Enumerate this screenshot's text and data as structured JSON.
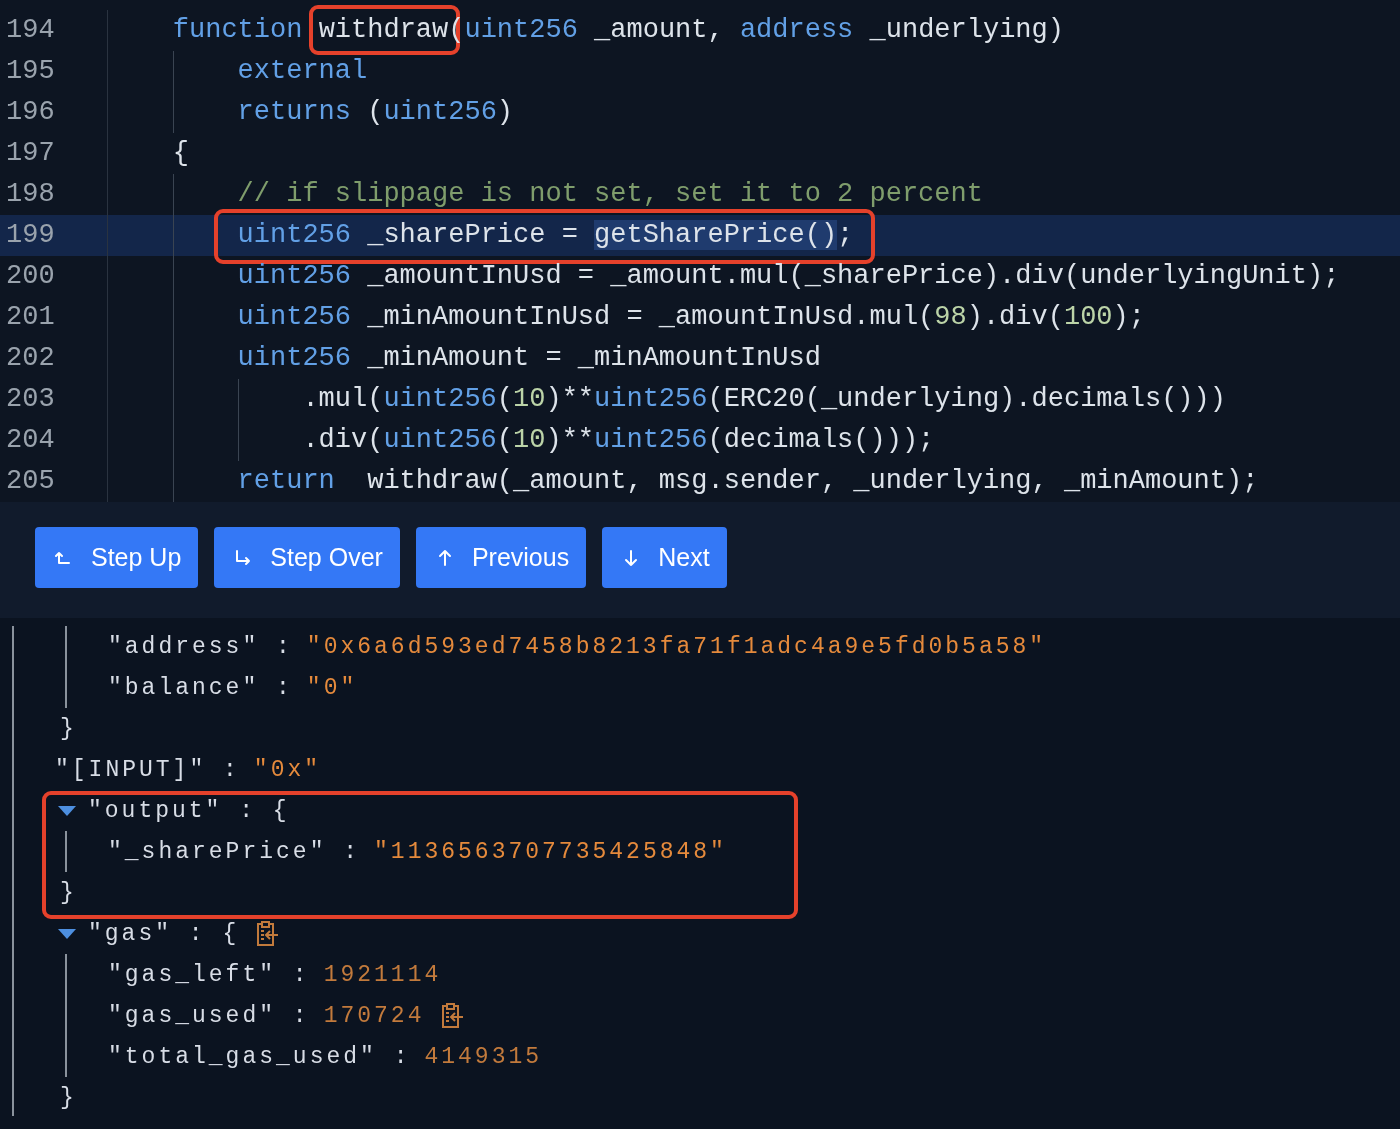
{
  "code_view": {
    "lines": [
      {
        "number": "194",
        "current": false,
        "segments": [
          {
            "kind": "keyword",
            "text": "function "
          },
          {
            "kind": "plain",
            "text": "withdraw",
            "boxed": true
          },
          {
            "kind": "plain",
            "text": "("
          },
          {
            "kind": "keyword",
            "text": "uint256"
          },
          {
            "kind": "plain",
            "text": " _amount, "
          },
          {
            "kind": "keyword",
            "text": "address"
          },
          {
            "kind": "plain",
            "text": " _underlying)"
          }
        ],
        "children": [
          {
            "number": "195",
            "current": false,
            "segments": [
              {
                "kind": "keyword",
                "text": "external"
              }
            ]
          },
          {
            "number": "196",
            "current": false,
            "segments": [
              {
                "kind": "keyword",
                "text": "returns"
              },
              {
                "kind": "plain",
                "text": " ("
              },
              {
                "kind": "keyword",
                "text": "uint256"
              },
              {
                "kind": "plain",
                "text": ")"
              }
            ]
          }
        ]
      },
      {
        "number": "197",
        "current": false,
        "segments": [
          {
            "kind": "plain",
            "text": "{"
          }
        ],
        "children": [
          {
            "number": "198",
            "current": false,
            "segments": [
              {
                "kind": "comment",
                "text": "// if slippage is not set, set it to 2 percent"
              }
            ]
          },
          {
            "number": "199",
            "current": true,
            "boxed": true,
            "segments": [
              {
                "kind": "keyword",
                "text": "uint256"
              },
              {
                "kind": "plain",
                "text": " _sharePrice = "
              },
              {
                "kind": "selection",
                "text": "getSharePrice()"
              },
              {
                "kind": "plain",
                "text": ";"
              }
            ]
          },
          {
            "number": "200",
            "current": false,
            "segments": [
              {
                "kind": "keyword",
                "text": "uint256"
              },
              {
                "kind": "plain",
                "text": " _amountInUsd = _amount.mul(_sharePrice).div(underlyingUnit);"
              }
            ]
          },
          {
            "number": "201",
            "current": false,
            "segments": [
              {
                "kind": "keyword",
                "text": "uint256"
              },
              {
                "kind": "plain",
                "text": " _minAmountInUsd = _amountInUsd.mul("
              },
              {
                "kind": "number",
                "text": "98"
              },
              {
                "kind": "plain",
                "text": ").div("
              },
              {
                "kind": "number",
                "text": "100"
              },
              {
                "kind": "plain",
                "text": ");"
              }
            ]
          },
          {
            "number": "202",
            "current": false,
            "segments": [
              {
                "kind": "keyword",
                "text": "uint256"
              },
              {
                "kind": "plain",
                "text": " _minAmount = _minAmountInUsd"
              }
            ],
            "children": [
              {
                "number": "203",
                "current": false,
                "segments": [
                  {
                    "kind": "plain",
                    "text": ".mul("
                  },
                  {
                    "kind": "keyword",
                    "text": "uint256"
                  },
                  {
                    "kind": "plain",
                    "text": "("
                  },
                  {
                    "kind": "number",
                    "text": "10"
                  },
                  {
                    "kind": "plain",
                    "text": ")**"
                  },
                  {
                    "kind": "keyword",
                    "text": "uint256"
                  },
                  {
                    "kind": "plain",
                    "text": "(ERC20(_underlying).decimals()))"
                  }
                ]
              },
              {
                "number": "204",
                "current": false,
                "segments": [
                  {
                    "kind": "plain",
                    "text": ".div("
                  },
                  {
                    "kind": "keyword",
                    "text": "uint256"
                  },
                  {
                    "kind": "plain",
                    "text": "("
                  },
                  {
                    "kind": "number",
                    "text": "10"
                  },
                  {
                    "kind": "plain",
                    "text": ")**"
                  },
                  {
                    "kind": "keyword",
                    "text": "uint256"
                  },
                  {
                    "kind": "plain",
                    "text": "(decimals()));"
                  }
                ]
              }
            ]
          },
          {
            "number": "205",
            "current": false,
            "segments": [
              {
                "kind": "keyword",
                "text": "return"
              },
              {
                "kind": "plain",
                "text": "  withdraw(_amount, msg.sender, _underlying, _minAmount);"
              }
            ]
          }
        ]
      }
    ]
  },
  "toolbar": {
    "buttons": [
      {
        "label": "Step Up"
      },
      {
        "label": "Step Over"
      },
      {
        "label": "Previous"
      },
      {
        "label": "Next"
      }
    ]
  },
  "json_view": {
    "nodes": [
      {
        "kind": "partial",
        "close": "}",
        "children": [
          {
            "kind": "pair",
            "key": "\"address\" :",
            "value": "\"0x6a6d593ed7458b8213fa71f1adc4a9e5fd0b5a58\"",
            "color": "#e58a3c"
          },
          {
            "kind": "pair",
            "key": "\"balance\" :",
            "value": "\"0\"",
            "color": "#e58a3c"
          }
        ]
      },
      {
        "kind": "pair",
        "key": "\"[INPUT]\" :",
        "value": "\"0x\"",
        "color": "#e58a3c"
      },
      {
        "kind": "object",
        "key": "\"output\" : {",
        "expanded": true,
        "boxed": true,
        "close": "}",
        "children": [
          {
            "kind": "pair",
            "key": "\"_sharePrice\" :",
            "value": "\"1136563707735425848\"",
            "color": "#e58a3c"
          }
        ]
      },
      {
        "kind": "object",
        "key": "\"gas\" : {",
        "expanded": true,
        "copy": true,
        "close": "}",
        "children": [
          {
            "kind": "pair",
            "key": "\"gas_left\" :",
            "value": "1921114",
            "color": "#c27a3c"
          },
          {
            "kind": "pair",
            "key": "\"gas_used\" :",
            "value": "170724",
            "color": "#c27a3c",
            "copy": true
          },
          {
            "kind": "pair",
            "key": "\"total_gas_used\" :",
            "value": "4149315",
            "color": "#c27a3c"
          }
        ]
      }
    ]
  }
}
